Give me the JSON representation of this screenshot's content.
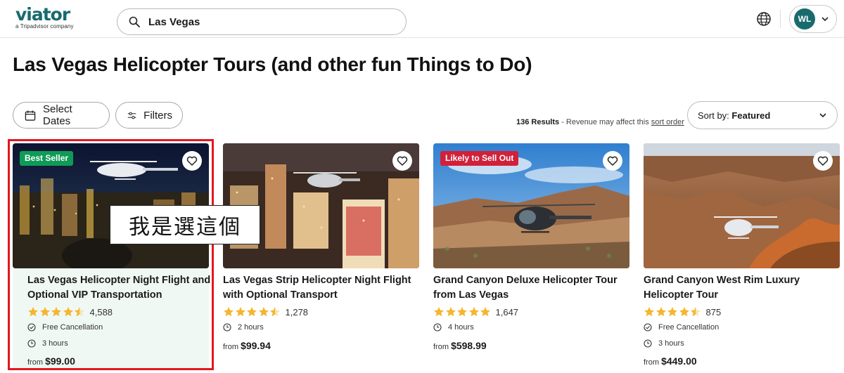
{
  "header": {
    "logo_word": "viator",
    "logo_tagline": "a Tripadvisor company",
    "search_value": "Las Vegas",
    "account_initials": "WL"
  },
  "page": {
    "title": "Las Vegas Helicopter Tours (and other fun Things to Do)"
  },
  "filters": {
    "dates_label": "Select Dates",
    "filters_label": "Filters",
    "results_count": "136 Results",
    "results_note": " - Revenue may affect this ",
    "sort_order_link": "sort order",
    "sort_prefix": "Sort by: ",
    "sort_value": "Featured"
  },
  "annotation": {
    "note_text": "我是選這個"
  },
  "cards": [
    {
      "badge": "Best Seller",
      "badge_color": "#0f9b56",
      "title": "Las Vegas Helicopter Night Flight and Optional VIP Transportation",
      "rating": 4.5,
      "review_count": "4,588",
      "free_cancellation": "Free Cancellation",
      "duration": "3 hours",
      "price_prefix": "from",
      "price": "$99.00"
    },
    {
      "badge": "",
      "title": "Las Vegas Strip Helicopter Night Flight with Optional Transport",
      "rating": 4.5,
      "review_count": "1,278",
      "duration": "2 hours",
      "price_prefix": "from",
      "price": "$99.94"
    },
    {
      "badge": "Likely to Sell Out",
      "badge_color": "#d1213a",
      "title": "Grand Canyon Deluxe Helicopter Tour from Las Vegas",
      "rating": 5,
      "review_count": "1,647",
      "duration": "4 hours",
      "price_prefix": "from",
      "price": "$598.99"
    },
    {
      "badge": "",
      "title": "Grand Canyon West Rim Luxury Helicopter Tour",
      "rating": 4.5,
      "review_count": "875",
      "free_cancellation": "Free Cancellation",
      "duration": "3 hours",
      "price_prefix": "from",
      "price": "$449.00"
    }
  ],
  "colors": {
    "star": "#f5b52e",
    "brand": "#186b6d",
    "highlight_frame": "#e0181f"
  }
}
